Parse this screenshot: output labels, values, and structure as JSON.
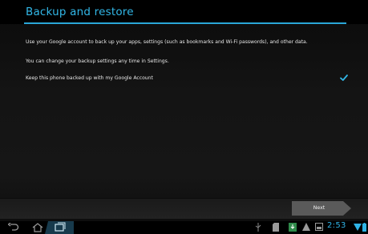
{
  "header": {
    "title": "Backup and restore"
  },
  "body": {
    "line1": "Use your Google account to back up your apps, settings (such as bookmarks and Wi-Fi passwords), and other data.",
    "line2": "You can change your backup settings any time in Settings.",
    "backup_option": {
      "label": "Keep this phone backed up with my Google Account",
      "checked": true
    }
  },
  "footer": {
    "next_label": "Next"
  },
  "status_bar": {
    "time": "2:53"
  },
  "icons": {
    "back": "back-arrow-icon",
    "home": "home-icon",
    "recent": "recent-apps-icon",
    "usb": "usb-icon",
    "sdcard": "sd-card-icon",
    "download": "download-icon",
    "warning": "warning-icon",
    "screenshot": "screenshot-icon",
    "wifi": "wifi-icon",
    "battery": "battery-icon"
  },
  "colors": {
    "accent": "#32b8e8",
    "background": "#141414"
  }
}
